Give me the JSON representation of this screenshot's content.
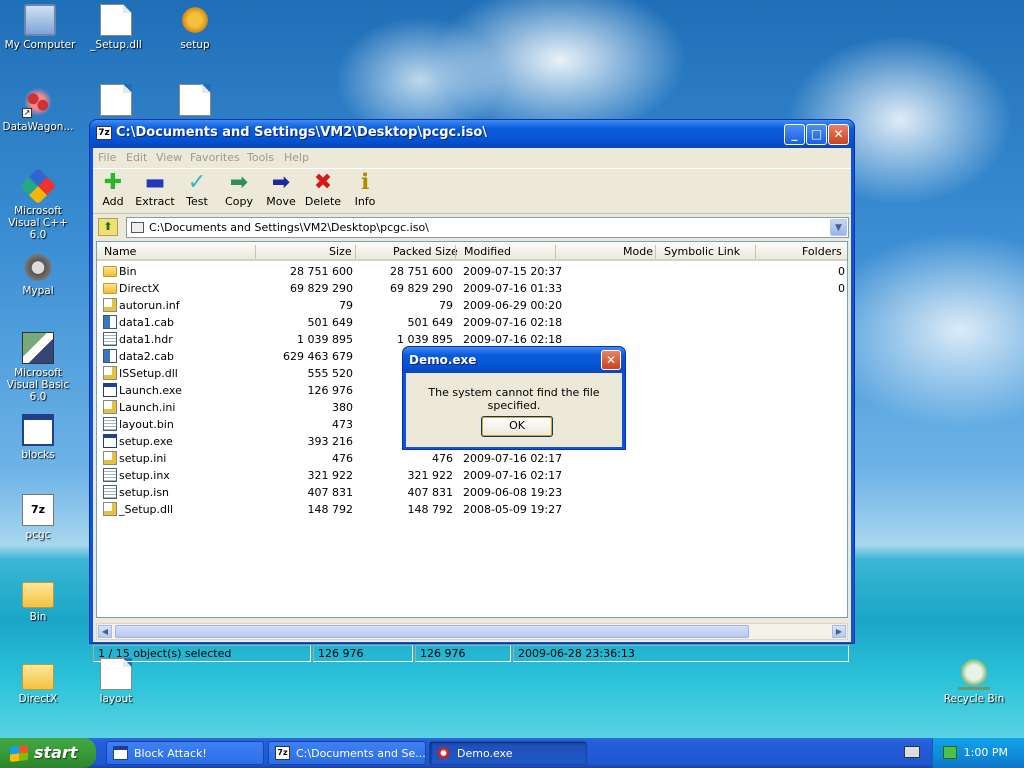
{
  "desktop": {
    "icons": [
      {
        "label": "My Computer"
      },
      {
        "label": "_Setup.dll"
      },
      {
        "label": "setup"
      },
      {
        "label": "DataWagon..."
      },
      {
        "label": "Microsoft Visual C++ 6.0"
      },
      {
        "label": "Mypal"
      },
      {
        "label": "Microsoft Visual Basic 6.0"
      },
      {
        "label": "blocks"
      },
      {
        "label": "pcgc"
      },
      {
        "label": "Bin"
      },
      {
        "label": "DirectX"
      },
      {
        "label": "layout"
      },
      {
        "label": "Recycle Bin"
      }
    ]
  },
  "window": {
    "title": "C:\\Documents and Settings\\VM2\\Desktop\\pcgc.iso\\",
    "app_icon": "7z",
    "menu": [
      "File",
      "Edit",
      "View",
      "Favorites",
      "Tools",
      "Help"
    ],
    "toolbar": [
      {
        "label": "Add",
        "icon": "plus-icon",
        "color": "#2bb52b"
      },
      {
        "label": "Extract",
        "icon": "minus-icon",
        "color": "#2437b8"
      },
      {
        "label": "Test",
        "icon": "check-icon",
        "color": "#2fb7c8"
      },
      {
        "label": "Copy",
        "icon": "copy-arrow-icon",
        "color": "#2e8f59"
      },
      {
        "label": "Move",
        "icon": "move-arrow-icon",
        "color": "#1d2a9e"
      },
      {
        "label": "Delete",
        "icon": "delete-x-icon",
        "color": "#d81818"
      },
      {
        "label": "Info",
        "icon": "info-icon",
        "color": "#b08a00"
      }
    ],
    "address": "C:\\Documents and Settings\\VM2\\Desktop\\pcgc.iso\\",
    "columns": [
      "Name",
      "Size",
      "Packed Size",
      "Modified",
      "Mode",
      "Symbolic Link",
      "Folders"
    ],
    "files": [
      {
        "name": "Bin",
        "size": "28 751 600",
        "packed": "28 751 600",
        "modified": "2009-07-15 20:37",
        "folders": "0",
        "kind": "folder"
      },
      {
        "name": "DirectX",
        "size": "69 829 290",
        "packed": "69 829 290",
        "modified": "2009-07-16 01:33",
        "folders": "0",
        "kind": "folder"
      },
      {
        "name": "autorun.inf",
        "size": "79",
        "packed": "79",
        "modified": "2009-06-29 00:20",
        "folders": "",
        "kind": "cfg"
      },
      {
        "name": "data1.cab",
        "size": "501 649",
        "packed": "501 649",
        "modified": "2009-07-16 02:18",
        "folders": "",
        "kind": "cab"
      },
      {
        "name": "data1.hdr",
        "size": "1 039 895",
        "packed": "1 039 895",
        "modified": "2009-07-16 02:18",
        "folders": "",
        "kind": "bin"
      },
      {
        "name": "data2.cab",
        "size": "629 463 679",
        "packed": "629",
        "modified": "",
        "folders": "",
        "kind": "cab"
      },
      {
        "name": "ISSetup.dll",
        "size": "555 520",
        "packed": "",
        "modified": "",
        "folders": "",
        "kind": "cfg"
      },
      {
        "name": "Launch.exe",
        "size": "126 976",
        "packed": "",
        "modified": "",
        "folders": "",
        "kind": "exe"
      },
      {
        "name": "Launch.ini",
        "size": "380",
        "packed": "",
        "modified": "",
        "folders": "",
        "kind": "cfg"
      },
      {
        "name": "layout.bin",
        "size": "473",
        "packed": "",
        "modified": "",
        "folders": "",
        "kind": "bin"
      },
      {
        "name": "setup.exe",
        "size": "393 216",
        "packed": "",
        "modified": "",
        "folders": "",
        "kind": "exe"
      },
      {
        "name": "setup.ini",
        "size": "476",
        "packed": "476",
        "modified": "2009-07-16 02:17",
        "folders": "",
        "kind": "cfg"
      },
      {
        "name": "setup.inx",
        "size": "321 922",
        "packed": "321 922",
        "modified": "2009-07-16 02:17",
        "folders": "",
        "kind": "bin"
      },
      {
        "name": "setup.isn",
        "size": "407 831",
        "packed": "407 831",
        "modified": "2009-06-08 19:23",
        "folders": "",
        "kind": "bin"
      },
      {
        "name": "_Setup.dll",
        "size": "148 792",
        "packed": "148 792",
        "modified": "2008-05-09 19:27",
        "folders": "",
        "kind": "cfg"
      }
    ],
    "status": {
      "selection": "1 / 15 object(s) selected",
      "size": "126 976",
      "packed": "126 976",
      "modified": "2009-06-28 23:36:13"
    }
  },
  "dialog": {
    "title": "Demo.exe",
    "message": "The system cannot find the file specified.",
    "ok_label": "OK"
  },
  "taskbar": {
    "start_label": "start",
    "tasks": [
      {
        "label": "Block Attack!"
      },
      {
        "label": "C:\\Documents and Se..."
      },
      {
        "label": "Demo.exe"
      }
    ],
    "clock": "1:00 PM"
  },
  "colors": {
    "xp_blue": "#0a54e0",
    "start_green": "#379b37",
    "face": "#ece9d8"
  }
}
